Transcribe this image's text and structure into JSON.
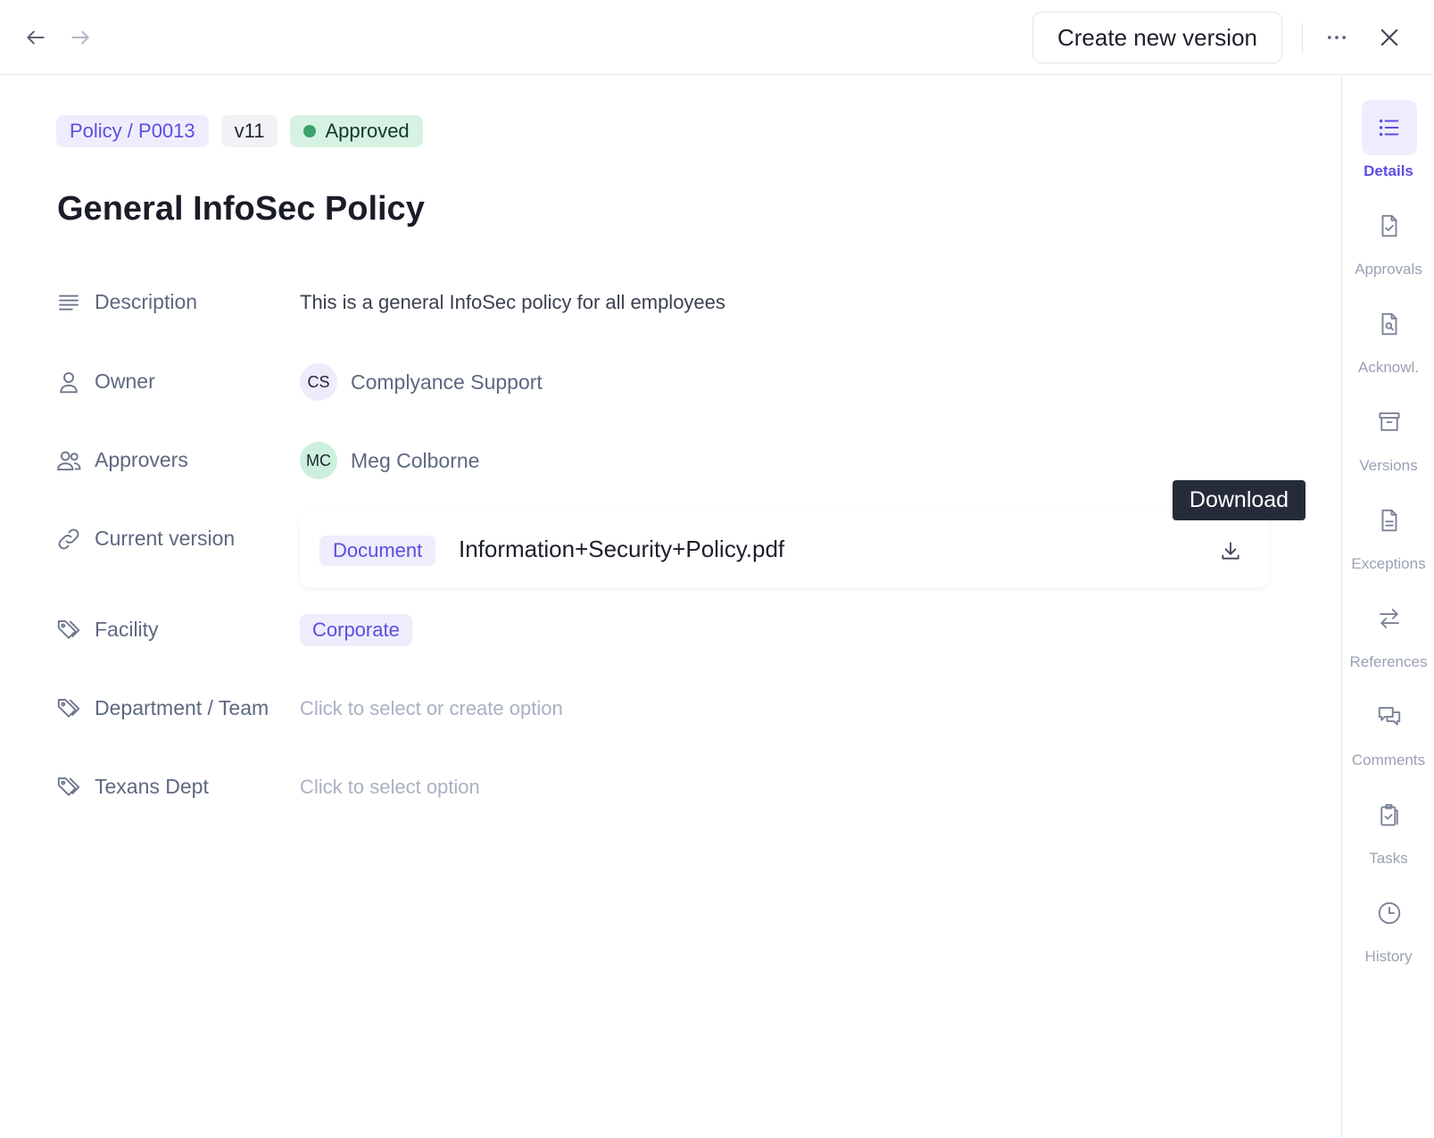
{
  "toolbar": {
    "back_icon": "arrow-left-icon",
    "forward_icon": "arrow-right-icon",
    "create_version_label": "Create new version",
    "more_icon": "more-horizontal-icon",
    "close_icon": "close-icon"
  },
  "header": {
    "policy_tag": "Policy / P0013",
    "version_tag": "v11",
    "status_tag": "Approved",
    "status_color": "#3aa36a",
    "title": "General InfoSec Policy"
  },
  "fields": {
    "description": {
      "label": "Description",
      "value": "This is a general InfoSec policy for all employees"
    },
    "owner": {
      "label": "Owner",
      "initials": "CS",
      "name": "Complyance Support"
    },
    "approvers": {
      "label": "Approvers",
      "initials": "MC",
      "name": "Meg Colborne"
    },
    "current_version": {
      "label": "Current version",
      "chip": "Document",
      "file_name": "Information+Security+Policy.pdf"
    },
    "facility": {
      "label": "Facility",
      "value": "Corporate"
    },
    "department": {
      "label": "Department / Team",
      "placeholder": "Click to select or create option"
    },
    "texans": {
      "label": "Texans Dept",
      "placeholder": "Click to select option"
    }
  },
  "tooltip": {
    "text": "Download"
  },
  "rail": {
    "items": [
      {
        "label": "Details",
        "icon": "list-icon",
        "active": true
      },
      {
        "label": "Approvals",
        "icon": "file-check-icon",
        "active": false
      },
      {
        "label": "Acknowl.",
        "icon": "file-search-icon",
        "active": false
      },
      {
        "label": "Versions",
        "icon": "archive-icon",
        "active": false
      },
      {
        "label": "Exceptions",
        "icon": "file-text-icon",
        "active": false
      },
      {
        "label": "References",
        "icon": "arrows-exchange-icon",
        "active": false
      },
      {
        "label": "Comments",
        "icon": "chat-bubbles-icon",
        "active": false
      },
      {
        "label": "Tasks",
        "icon": "clipboard-check-icon",
        "active": false
      },
      {
        "label": "History",
        "icon": "clock-icon",
        "active": false
      }
    ]
  },
  "colors": {
    "accent": "#5a4ee0",
    "accent_bg": "#efedfd",
    "label_gray": "#5d6880",
    "placeholder_gray": "#aab1c2"
  }
}
